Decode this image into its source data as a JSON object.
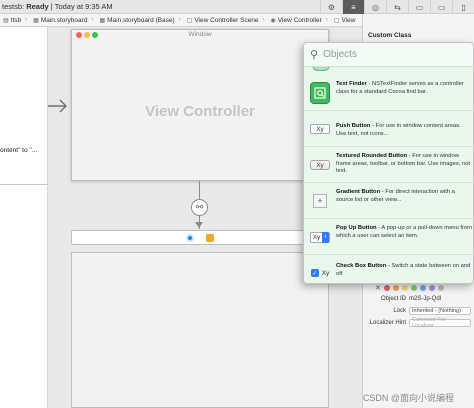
{
  "toolbar": {
    "status_project": "testsb:",
    "status_state": "Ready",
    "status_time": "| Today at 9:35 AM",
    "buttons": [
      {
        "glyph": "⚙",
        "name": "editor-options"
      },
      {
        "glyph": "≡",
        "name": "standard-editor"
      },
      {
        "glyph": "◎",
        "name": "assistant-editor"
      },
      {
        "glyph": "⇆",
        "name": "version-editor"
      },
      {
        "glyph": "▭",
        "name": "toggle-navigator"
      },
      {
        "glyph": "▭",
        "name": "toggle-debug"
      },
      {
        "glyph": "▯",
        "name": "toggle-inspector"
      }
    ]
  },
  "jumpbar": {
    "items": [
      {
        "label": "ttsb",
        "icon": "▤"
      },
      {
        "label": "Main.storyboard",
        "icon": "▦"
      },
      {
        "label": "Main.storyboard (Base)",
        "icon": "▦"
      },
      {
        "label": "View Controller Scene",
        "icon": "▢"
      },
      {
        "label": "View Controller",
        "icon": "◉"
      },
      {
        "label": "View",
        "icon": "▢"
      }
    ]
  },
  "outline": {
    "text": "ontent\" to \"..."
  },
  "canvas": {
    "window_title": "Window",
    "view_controller_label": "View Controller"
  },
  "library": {
    "search_placeholder": "Objects",
    "items": [
      {
        "name": "Text Finder",
        "desc": " - NSTextFinder serves as a controller class for a standard Cocoa find bar.",
        "thumb": "finder",
        "thumb_text": ""
      },
      {
        "name": "Push Button",
        "desc": " - For use in window content areas. Use text, not icons...",
        "thumb": "push",
        "thumb_text": "Xy"
      },
      {
        "name": "Textured Rounded Button",
        "desc": " - For use in window frame areas, toolbar, or bottom bar. Use images, not text.",
        "thumb": "textured",
        "thumb_text": "Xy"
      },
      {
        "name": "Gradient Button",
        "desc": " - For direct interaction with a source list or other view...",
        "thumb": "gradient",
        "thumb_text": "+"
      },
      {
        "name": "Pop Up Button",
        "desc": " - A pop-up or a pull-down menu from which a user can select an item.",
        "thumb": "popup",
        "thumb_text": "Xy"
      },
      {
        "name": "Check Box Button",
        "desc": " - Switch a state between on and off",
        "thumb": "check",
        "thumb_text": "Xy"
      }
    ]
  },
  "inspector": {
    "section_title": "Custom Class",
    "colors": [
      "#e06666",
      "#f1a35c",
      "#f5d76e",
      "#7fcf73",
      "#6aa9e8",
      "#b38ad8",
      "#bdbdbd"
    ],
    "object_id_label": "Object ID",
    "object_id_value": "m2S-Jp-Qdl",
    "lock_label": "Lock",
    "lock_value": "Inherited - (Nothing)",
    "localizer_label": "Localizer Hint",
    "localizer_placeholder": "Comment For Localizer"
  },
  "watermark": "CSDN @面向小说编程"
}
